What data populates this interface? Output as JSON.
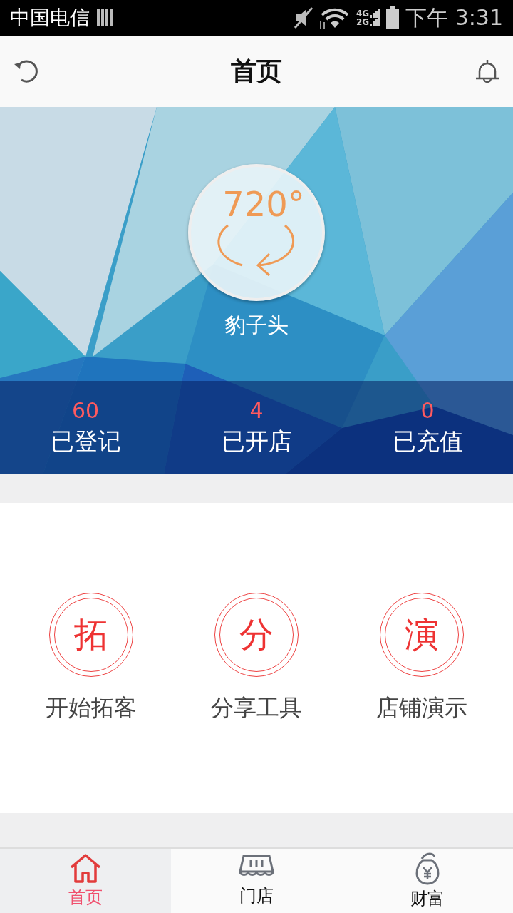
{
  "status_bar": {
    "carrier": "中国电信",
    "network_4g": "4G",
    "network_2g": "2G",
    "time": "下午 3:31"
  },
  "header": {
    "title": "首页"
  },
  "profile": {
    "avatar_text": "720°",
    "name": "豹子头"
  },
  "stats": [
    {
      "value": "60",
      "label": "已登记"
    },
    {
      "value": "4",
      "label": "已开店"
    },
    {
      "value": "0",
      "label": "已充值"
    }
  ],
  "actions": [
    {
      "glyph": "拓",
      "label": "开始拓客"
    },
    {
      "glyph": "分",
      "label": "分享工具"
    },
    {
      "glyph": "演",
      "label": "店铺演示"
    }
  ],
  "tab_bar": [
    {
      "kind": "home",
      "label": "首页",
      "selected": true
    },
    {
      "kind": "store",
      "label": "门店",
      "selected": false
    },
    {
      "kind": "wealth",
      "label": "财富",
      "selected": false
    }
  ]
}
